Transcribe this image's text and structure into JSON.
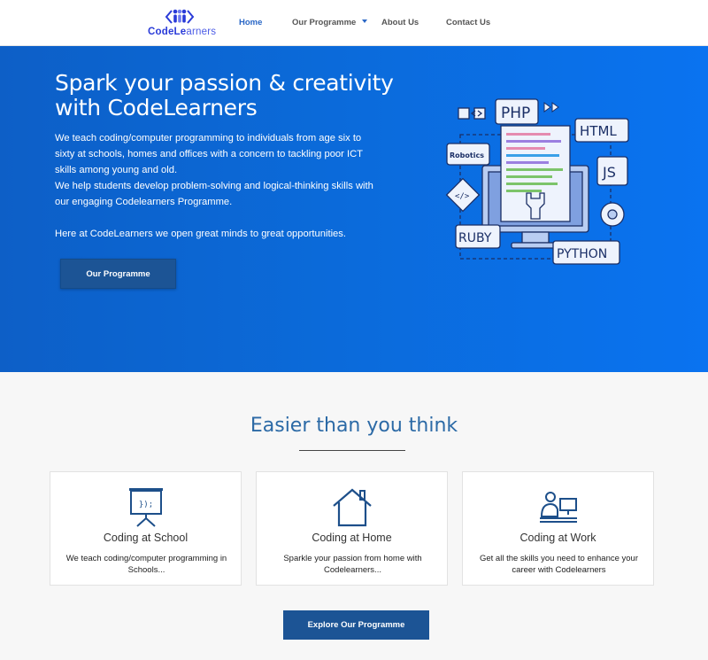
{
  "brand": {
    "name_bold": "CodeLe",
    "name_thin": "arners",
    "logo_icon": "people-code-icon",
    "accent": "#2a3bd8"
  },
  "nav": {
    "home": "Home",
    "programme": "Our Programme",
    "about": "About Us",
    "contact": "Contact Us",
    "active_color": "#2a67c6"
  },
  "hero": {
    "title": "Spark your passion & creativity with CodeLearners",
    "para1": "We teach coding/computer programming to individuals from age six to sixty at schools, homes and offices with a concern to tackling poor ICT skills among young and old.",
    "para2": "We help students develop problem-solving and logical-thinking skills with our engaging Codelearners Programme.",
    "para3": "Here at CodeLearners we open great minds to great opportunities.",
    "button": "Our Programme",
    "background": "#0b6ad9",
    "illustration": {
      "icon": "programming-languages-monitor-illustration",
      "labels": {
        "php": "PHP",
        "html": "HTML",
        "js": "JS",
        "robotics": "Robotics",
        "ruby": "RUBY",
        "python": "PYTHON"
      }
    }
  },
  "features": {
    "title": "Easier than you think",
    "cards": [
      {
        "icon": "presentation-board-icon",
        "board_text": "});",
        "title": "Coding at School",
        "desc": "We teach coding/computer programming in Schools..."
      },
      {
        "icon": "house-icon",
        "title": "Coding at Home",
        "desc": "Sparkle your passion from home with Codelearners..."
      },
      {
        "icon": "person-at-computer-icon",
        "title": "Coding at Work",
        "desc": "Get all the skills you need to enhance your career with Codelearners"
      }
    ],
    "button": "Explore Our Programme"
  }
}
